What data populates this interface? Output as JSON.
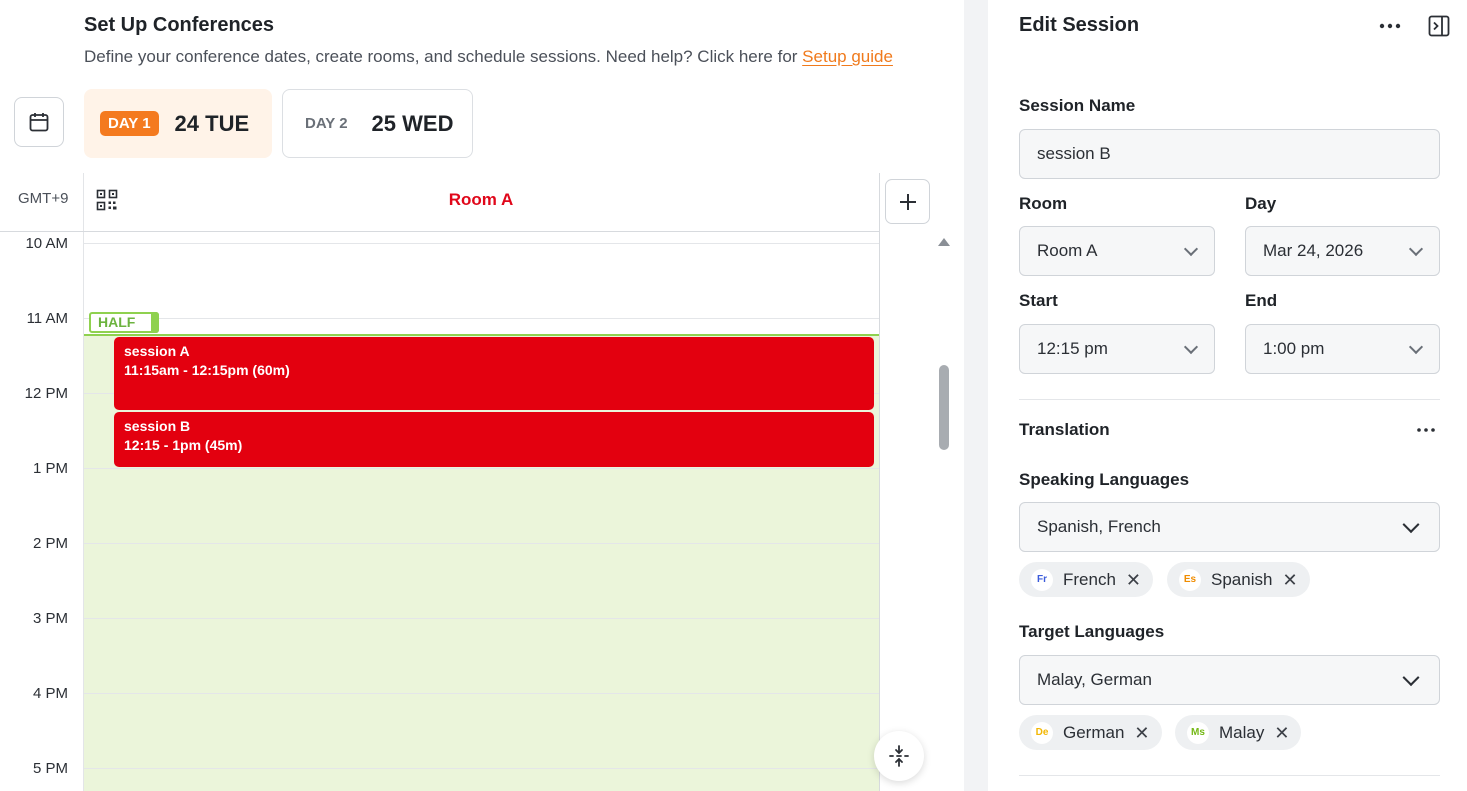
{
  "header": {
    "title": "Set Up Conferences",
    "subtitle": "Define your conference dates, create rooms, and schedule sessions. Need help? Click here for ",
    "guide_link": "Setup guide"
  },
  "days": [
    {
      "label": "DAY 1",
      "date": "24 TUE",
      "active": true
    },
    {
      "label": "DAY 2",
      "date": "25 WED",
      "active": false
    }
  ],
  "calendar": {
    "timezone": "GMT+9",
    "room": "Room A",
    "hours": [
      "10 AM",
      "11 AM",
      "12 PM",
      "1 PM",
      "2 PM",
      "3 PM",
      "4 PM",
      "5 PM"
    ],
    "half_badge": "HALF",
    "sessions": [
      {
        "name": "session A",
        "time": "11:15am - 12:15pm (60m)"
      },
      {
        "name": "session B",
        "time": "12:15 - 1pm (45m)"
      }
    ]
  },
  "panel": {
    "title": "Edit Session",
    "session_name_label": "Session Name",
    "session_name_value": "session B",
    "room_label": "Room",
    "room_value": "Room A",
    "day_label": "Day",
    "day_value": "Mar 24, 2026",
    "start_label": "Start",
    "start_value": "12:15 pm",
    "end_label": "End",
    "end_value": "1:00 pm",
    "translation_label": "Translation",
    "speaking_label": "Speaking Languages",
    "speaking_value": "Spanish, French",
    "speaking_chips": [
      {
        "code": "Fr",
        "name": "French",
        "color": "#3b5bdb"
      },
      {
        "code": "Es",
        "name": "Spanish",
        "color": "#f08c00"
      }
    ],
    "target_label": "Target Languages",
    "target_value": "Malay, German",
    "target_chips": [
      {
        "code": "De",
        "name": "German",
        "color": "#f2b705"
      },
      {
        "code": "Ms",
        "name": "Malay",
        "color": "#74b816"
      }
    ]
  },
  "colors": {
    "accent_orange": "#f47a1f",
    "session_red": "#e3000f",
    "half_green": "#8fd14f"
  },
  "icons": [
    "calendar-icon",
    "qr-code-icon",
    "plus-icon",
    "compress-icon",
    "more-icon",
    "collapse-panel-icon",
    "chevron-down-icon",
    "close-icon"
  ]
}
